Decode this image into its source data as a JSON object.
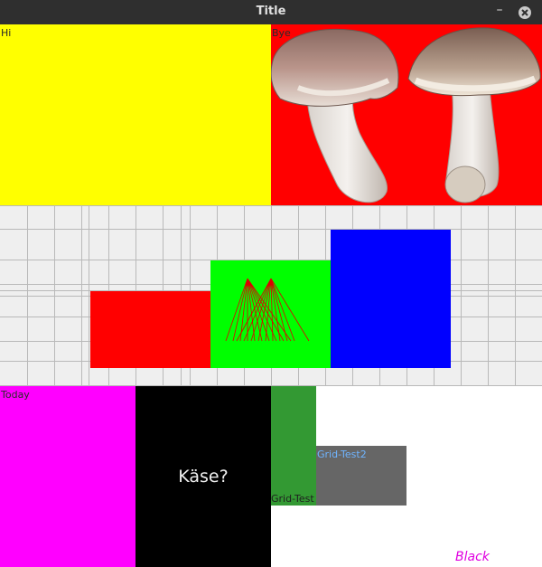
{
  "window": {
    "title": "Title"
  },
  "labels": {
    "hi": "Hi",
    "bye": "Bye",
    "today": "Today",
    "kase": "Käse?",
    "grid_test": "Grid-Test",
    "grid_test2": "Grid-Test2",
    "black": "Black"
  },
  "icons": {
    "minimize": "minimize-icon",
    "close": "close-icon",
    "image": "mushrooms-image"
  },
  "colors": {
    "yellow": "#ffff00",
    "red": "#ff0000",
    "green": "#00ff00",
    "blue": "#0000ff",
    "magenta": "#ff00ff",
    "black": "#000000",
    "dark_green": "#339933",
    "gray": "#666666",
    "black_label": "#e000e0",
    "grid_test2_label": "#6fb4ff"
  }
}
